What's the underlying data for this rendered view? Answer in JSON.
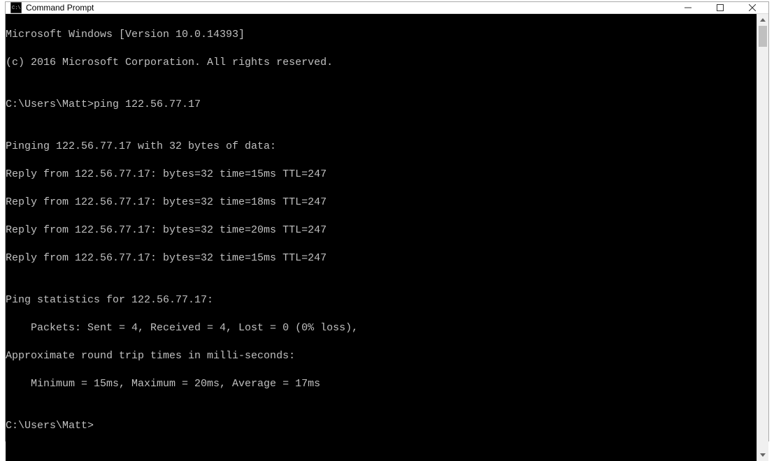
{
  "window": {
    "title": "Command Prompt"
  },
  "console": {
    "lines": [
      "Microsoft Windows [Version 10.0.14393]",
      "(c) 2016 Microsoft Corporation. All rights reserved.",
      "",
      "C:\\Users\\Matt>ping 122.56.77.17",
      "",
      "Pinging 122.56.77.17 with 32 bytes of data:",
      "Reply from 122.56.77.17: bytes=32 time=15ms TTL=247",
      "Reply from 122.56.77.17: bytes=32 time=18ms TTL=247",
      "Reply from 122.56.77.17: bytes=32 time=20ms TTL=247",
      "Reply from 122.56.77.17: bytes=32 time=15ms TTL=247",
      "",
      "Ping statistics for 122.56.77.17:",
      "    Packets: Sent = 4, Received = 4, Lost = 0 (0% loss),",
      "Approximate round trip times in milli-seconds:",
      "    Minimum = 15ms, Maximum = 20ms, Average = 17ms",
      "",
      "C:\\Users\\Matt>"
    ]
  }
}
